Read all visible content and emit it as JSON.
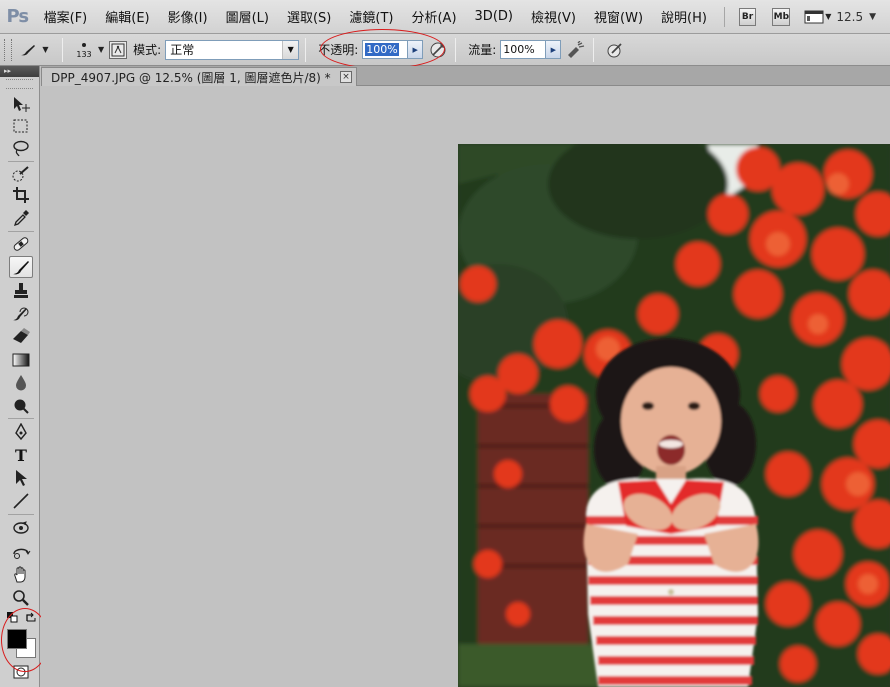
{
  "app": {
    "logo": "Ps"
  },
  "menu": {
    "items": [
      "檔案(F)",
      "編輯(E)",
      "影像(I)",
      "圖層(L)",
      "選取(S)",
      "濾鏡(T)",
      "分析(A)",
      "3D(D)",
      "檢視(V)",
      "視窗(W)",
      "說明(H)"
    ],
    "bridge_label": "Br",
    "minibridge_label": "Mb",
    "zoom_value": "12.5"
  },
  "options": {
    "brush_size": "133",
    "mode_label": "模式:",
    "mode_value": "正常",
    "opacity_label": "不透明:",
    "opacity_value": "100%",
    "flow_label": "流量:",
    "flow_value": "100%"
  },
  "document": {
    "tab_title": "DPP_4907.JPG @ 12.5% (圖層 1, 圖層遮色片/8) *",
    "close_glyph": "×"
  },
  "toolbox": {
    "tools": [
      {
        "name": "move-tool",
        "icon": "move-icon"
      },
      {
        "name": "marquee-tool",
        "icon": "rect-marquee-icon"
      },
      {
        "name": "lasso-tool",
        "icon": "lasso-icon"
      },
      {
        "name": "quick-select-tool",
        "icon": "quick-select-icon"
      },
      {
        "name": "crop-tool",
        "icon": "crop-icon"
      },
      {
        "name": "eyedropper-tool",
        "icon": "eyedropper-icon"
      },
      {
        "name": "healing-brush-tool",
        "icon": "bandage-icon"
      },
      {
        "name": "brush-tool",
        "icon": "brush-icon"
      },
      {
        "name": "clone-stamp-tool",
        "icon": "stamp-icon"
      },
      {
        "name": "history-brush-tool",
        "icon": "history-brush-icon"
      },
      {
        "name": "eraser-tool",
        "icon": "eraser-icon"
      },
      {
        "name": "gradient-tool",
        "icon": "gradient-icon"
      },
      {
        "name": "blur-tool",
        "icon": "drop-icon"
      },
      {
        "name": "dodge-tool",
        "icon": "dodge-icon"
      },
      {
        "name": "pen-tool",
        "icon": "pen-icon"
      },
      {
        "name": "type-tool",
        "icon": "type-icon"
      },
      {
        "name": "path-select-tool",
        "icon": "arrow-icon"
      },
      {
        "name": "line-tool",
        "icon": "line-icon"
      },
      {
        "name": "3d-rotate-tool",
        "icon": "3d-rotate-icon"
      },
      {
        "name": "3d-orbit-tool",
        "icon": "3d-orbit-icon"
      },
      {
        "name": "hand-tool",
        "icon": "hand-icon"
      },
      {
        "name": "zoom-tool",
        "icon": "magnifier-icon"
      }
    ],
    "type_glyph": "T",
    "foreground_color": "#000000",
    "background_color": "#ffffff"
  },
  "colors": {
    "annotation_red": "#d81c1c",
    "selection_blue": "#316ac5"
  }
}
